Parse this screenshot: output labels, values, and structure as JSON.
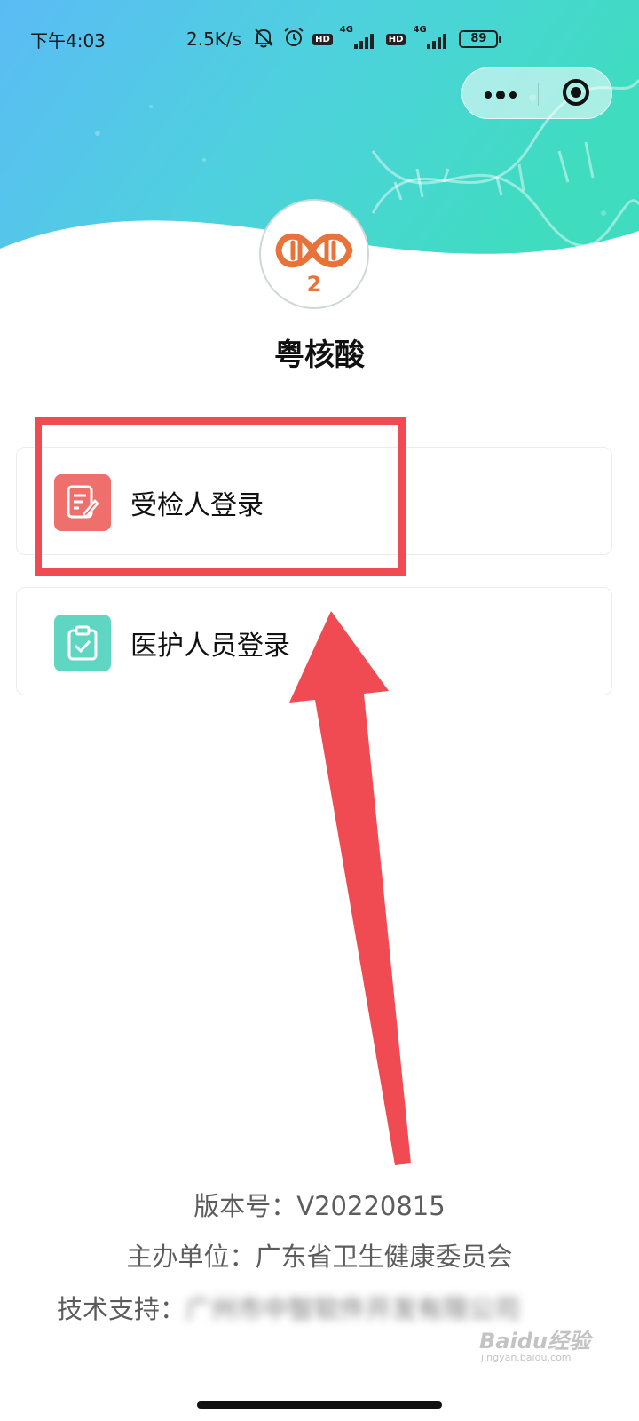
{
  "status_bar": {
    "time": "下午4:03",
    "net_speed": "2.5K/s",
    "hd_badge": "HD",
    "network_type": "4G",
    "battery": "89"
  },
  "capsule": {
    "more_icon": "more-dots-icon",
    "close_icon": "target-circle-icon"
  },
  "app": {
    "title": "粤核酸",
    "logo_digit": "2"
  },
  "login_options": [
    {
      "label": "受检人登录",
      "icon": "edit-document-icon",
      "color": "#ee6f6b"
    },
    {
      "label": "医护人员登录",
      "icon": "clipboard-check-icon",
      "color": "#5fd6c2"
    }
  ],
  "footer": {
    "version": "版本号：V20220815",
    "sponsor": "主办单位：广东省卫生健康委员会",
    "support_label": "技术支持：",
    "support_value": "广州市中智软件开发有限公司"
  },
  "watermark": {
    "main": "Baidu经验",
    "sub": "jingyan.baidu.com"
  },
  "colors": {
    "annotation": "#f04a52",
    "header_start": "#5bbcf5",
    "header_end": "#3fdcc0"
  }
}
